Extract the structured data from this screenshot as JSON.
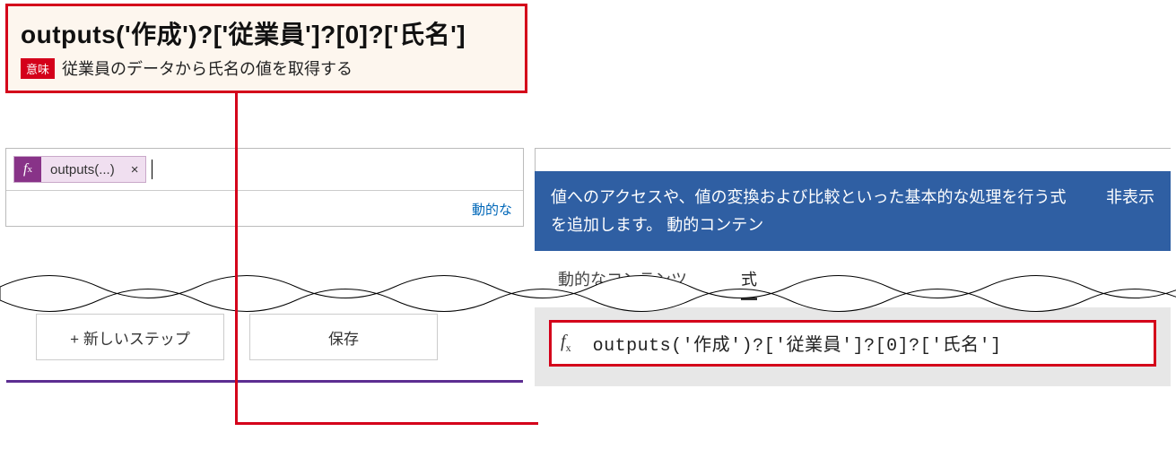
{
  "callout": {
    "expression": "outputs('作成')?['従業員']?[0]?['氏名']",
    "badge": "意味",
    "description": "従業員のデータから氏名の値を取得する"
  },
  "left_panel": {
    "token": {
      "fx": "f",
      "fx_sub": "x",
      "label": "outputs(...)",
      "close": "×"
    },
    "dynamic_link": "動的な"
  },
  "buttons": {
    "new_step": "+ 新しいステップ",
    "save": "保存"
  },
  "right_panel": {
    "help_text": "値へのアクセスや、値の変換および比較といった基本的な処理を行う式を追加します。 動的コンテン",
    "help_hide": "非表示",
    "tabs": {
      "dynamic": "動的なコンテンツ",
      "expression": "式"
    },
    "fx": "f",
    "fx_sub": "x",
    "expression_text": "outputs('作成')?['従業員']?[0]?['氏名']"
  }
}
